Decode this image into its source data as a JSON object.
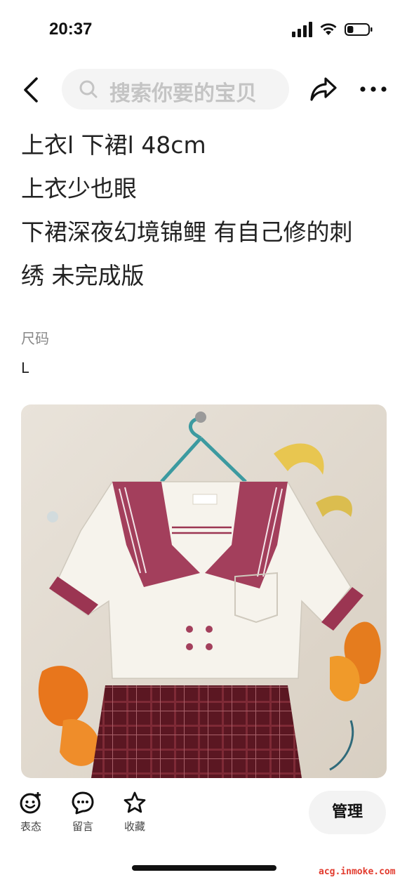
{
  "status_bar": {
    "time": "20:37",
    "battery_level": 0.3
  },
  "nav": {
    "search_placeholder": "搜索你要的宝贝",
    "icons": [
      "back-arrow-icon",
      "search-icon",
      "share-icon",
      "more-icon"
    ]
  },
  "description": {
    "lines": [
      "上衣l 下裙l 48cm",
      "上衣少也眼",
      "下裙深夜幻境锦鲤 有自己修的刺",
      "绣 未完成版"
    ]
  },
  "attributes": {
    "size_label": "尺码",
    "size_value": "L"
  },
  "bottom_bar": {
    "react_label": "表态",
    "comment_label": "留言",
    "favorite_label": "收藏",
    "manage_label": "管理"
  },
  "watermark": "acg.inmoke.com",
  "colors": {
    "accent_text": "#222222",
    "muted_text": "#888888",
    "watermark": "#e23b2e"
  }
}
